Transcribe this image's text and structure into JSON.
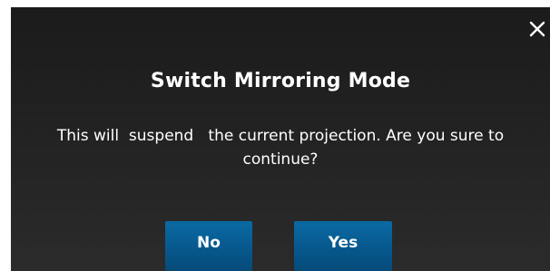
{
  "dialog": {
    "title": "Switch Mirroring Mode",
    "message": "This will  suspend   the current projection. Are you sure to continue?",
    "close_icon": "close-icon",
    "buttons": {
      "no_label": "No",
      "yes_label": "Yes"
    },
    "colors": {
      "background": "#222222",
      "button": "#07588d",
      "text": "#ffffff"
    }
  }
}
